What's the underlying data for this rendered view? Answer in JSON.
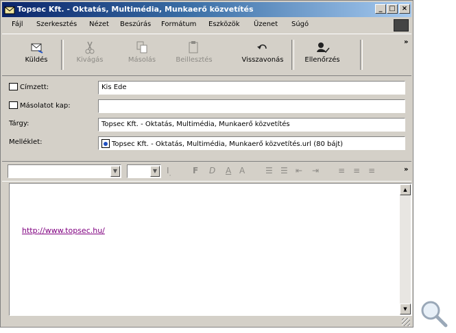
{
  "window": {
    "title": "Topsec Kft. - Oktatás, Multimédia, Munkaerő közvetítés",
    "minimize": "_",
    "maximize": "□",
    "close": "×"
  },
  "menu": [
    "Fájl",
    "Szerkesztés",
    "Nézet",
    "Beszúrás",
    "Formátum",
    "Eszközök",
    "Üzenet",
    "Súgó"
  ],
  "toolbar": {
    "send": "Küldés",
    "cut": "Kivágás",
    "copy": "Másolás",
    "paste": "Beillesztés",
    "undo": "Visszavonás",
    "check": "Ellenőrzés",
    "more": "»"
  },
  "header": {
    "to_label": "Címzett:",
    "to_value": "Kis Ede",
    "cc_label": "Másolatot kap:",
    "cc_value": "",
    "subject_label": "Tárgy:",
    "subject_value": "Topsec Kft. - Oktatás, Multimédia, Munkaerő közvetítés",
    "attach_label": "Melléklet:",
    "attach_value": "Topsec Kft. - Oktatás, Multimédia, Munkaerő közvetítés.url (80 bájt)"
  },
  "format": {
    "font_value": "",
    "size_value": "",
    "more": "»"
  },
  "body": {
    "link": "http://www.topsec.hu/"
  },
  "colors": {
    "title_start": "#0a246a",
    "title_end": "#a6caf0",
    "face": "#d4d0c8",
    "link": "#800080"
  }
}
